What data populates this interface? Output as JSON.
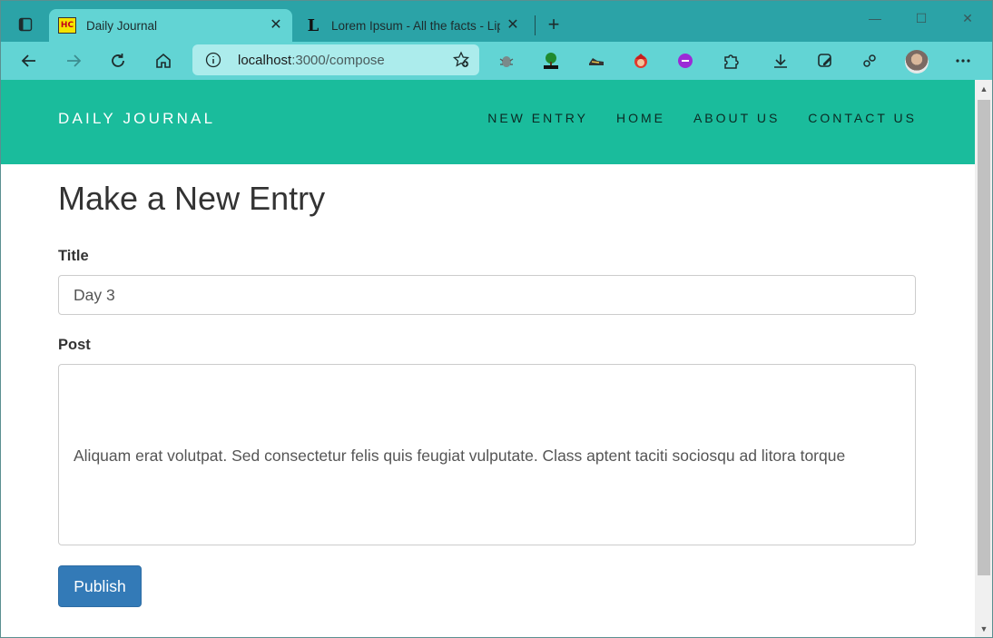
{
  "browser": {
    "tabs": [
      {
        "title": "Daily Journal",
        "favicon": "HC",
        "active": true
      },
      {
        "title": "Lorem Ipsum - All the facts - Lipsum",
        "favicon": "L",
        "active": false
      }
    ],
    "address": {
      "host": "localhost",
      "path": ":3000/compose"
    },
    "accent_color": "#62d4d4",
    "titlebar_color": "#2ba3a7"
  },
  "site": {
    "brand": "DAILY JOURNAL",
    "nav": [
      "NEW ENTRY",
      "HOME",
      "ABOUT US",
      "CONTACT US"
    ],
    "navbar_color": "#1abc9c"
  },
  "form": {
    "heading": "Make a New Entry",
    "title_label": "Title",
    "title_value": "Day 3",
    "post_label": "Post",
    "post_value": "Aliquam erat volutpat. Sed consectetur felis quis feugiat vulputate. Class aptent taciti sociosqu ad litora torque",
    "publish_label": "Publish",
    "publish_color": "#337ab7"
  }
}
